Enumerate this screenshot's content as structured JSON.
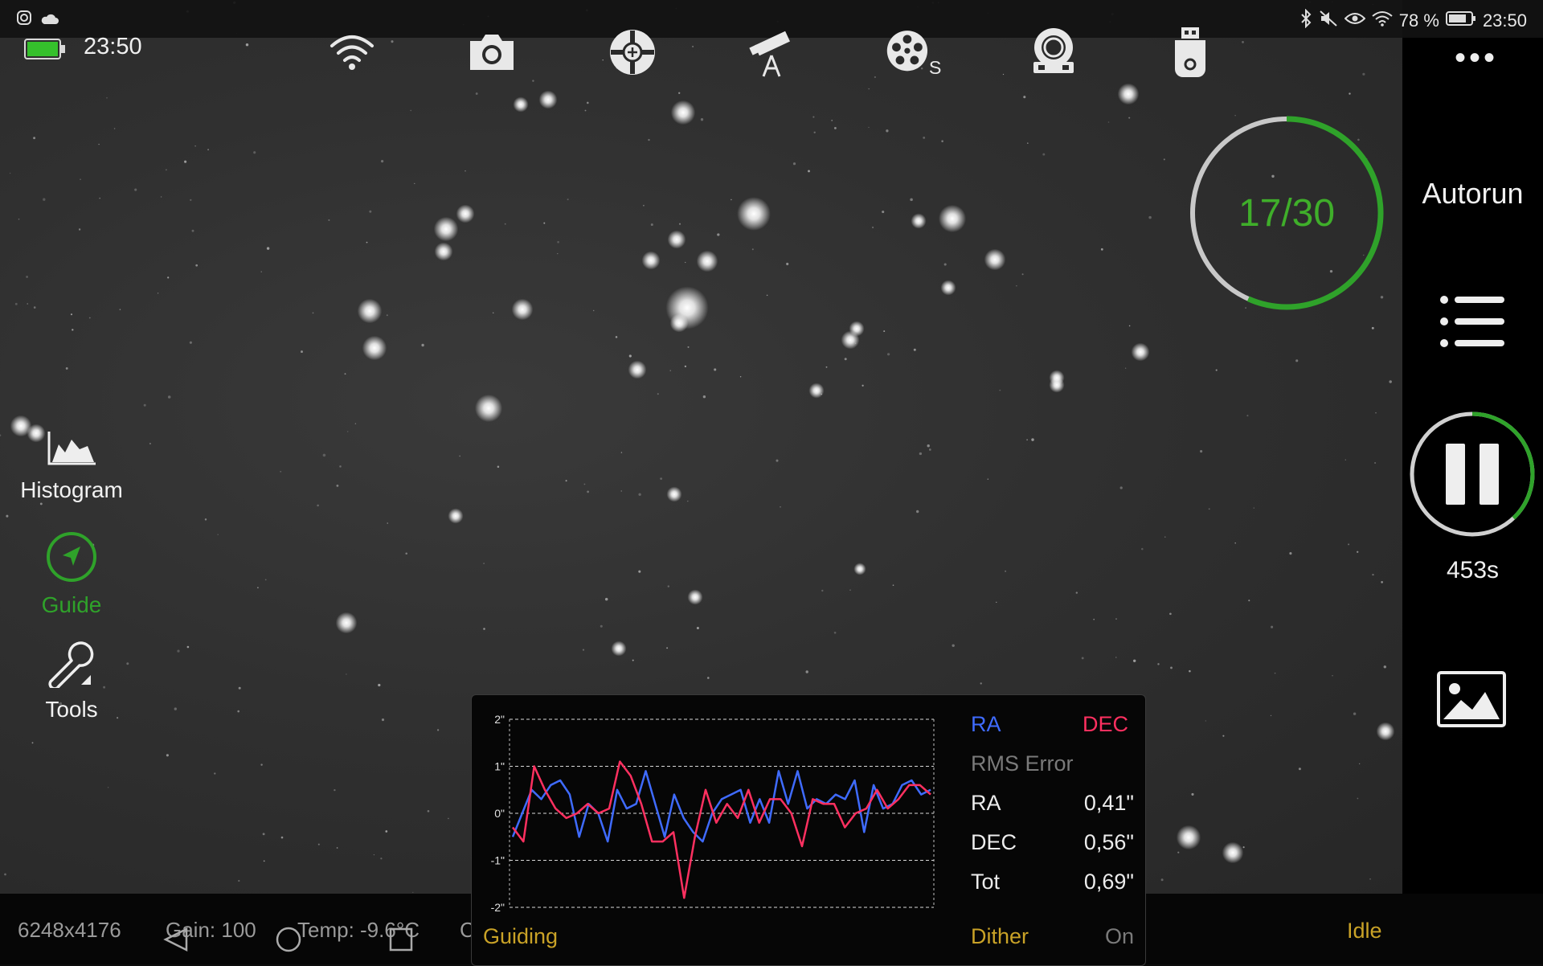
{
  "status_bar": {
    "battery_percent": "78 %",
    "time": "23:50"
  },
  "device": {
    "battery_level": 1.0,
    "time": "23:50"
  },
  "toolbar": {
    "icons": [
      "wifi-icon",
      "camera-icon",
      "guide-scope-icon",
      "telescope-mount-icon",
      "filter-wheel-icon",
      "focuser-icon",
      "usb-storage-icon"
    ],
    "filter_wheel_suffix": "S",
    "more_label": "•••"
  },
  "side_tools": {
    "histogram": "Histogram",
    "guide": "Guide",
    "tools": "Tools"
  },
  "sequence": {
    "progress_text": "17/30",
    "done": 17,
    "total": 30,
    "progress_color": "#2fa22a"
  },
  "right_panel": {
    "autorun": "Autorun",
    "remaining": "453s",
    "exposure_progress": 0.38
  },
  "bottom_bar": {
    "resolution": "6248x4176",
    "gain": "Gain: 100",
    "temp": "Temp: -9.6°C",
    "extra": "C",
    "state": "Idle"
  },
  "guiding": {
    "legend_ra": "RA",
    "legend_dec": "DEC",
    "rms_header": "RMS Error",
    "rows": [
      {
        "label": "RA",
        "value": "0,41\""
      },
      {
        "label": "DEC",
        "value": "0,56\""
      },
      {
        "label": "Tot",
        "value": "0,69\""
      }
    ],
    "status": "Guiding",
    "dither_label": "Dither",
    "dither_value": "On",
    "colors": {
      "ra": "#3f6bff",
      "dec": "#ff3060",
      "accent": "#c9a227"
    }
  },
  "chart_data": {
    "type": "line",
    "yticks": [
      "2\"",
      "1\"",
      "0\"",
      "-1\"",
      "-2\""
    ],
    "ylim": [
      -2,
      2
    ],
    "grid": true,
    "series": [
      {
        "name": "RA",
        "values": [
          -0.5,
          0.0,
          0.5,
          0.3,
          0.6,
          0.7,
          0.4,
          -0.5,
          0.2,
          0.0,
          -0.6,
          0.5,
          0.1,
          0.2,
          0.9,
          0.2,
          -0.5,
          0.4,
          -0.1,
          -0.4,
          -0.6,
          0.0,
          0.3,
          0.4,
          0.5,
          -0.2,
          0.3,
          -0.2,
          0.9,
          0.2,
          0.9,
          0.1,
          0.3,
          0.2,
          0.4,
          0.3,
          0.7,
          -0.4,
          0.6,
          0.1,
          0.2,
          0.6,
          0.7,
          0.4,
          0.5
        ]
      },
      {
        "name": "DEC",
        "values": [
          -0.3,
          -0.6,
          1.0,
          0.5,
          0.1,
          -0.1,
          0.0,
          0.2,
          0.0,
          0.1,
          1.1,
          0.8,
          0.2,
          -0.6,
          -0.6,
          -0.4,
          -1.8,
          -0.5,
          0.5,
          -0.2,
          0.2,
          -0.1,
          0.5,
          -0.2,
          0.3,
          0.3,
          0.0,
          -0.7,
          0.3,
          0.2,
          0.2,
          -0.3,
          0.0,
          0.1,
          0.5,
          0.1,
          0.3,
          0.6,
          0.6,
          0.4
        ]
      }
    ]
  }
}
